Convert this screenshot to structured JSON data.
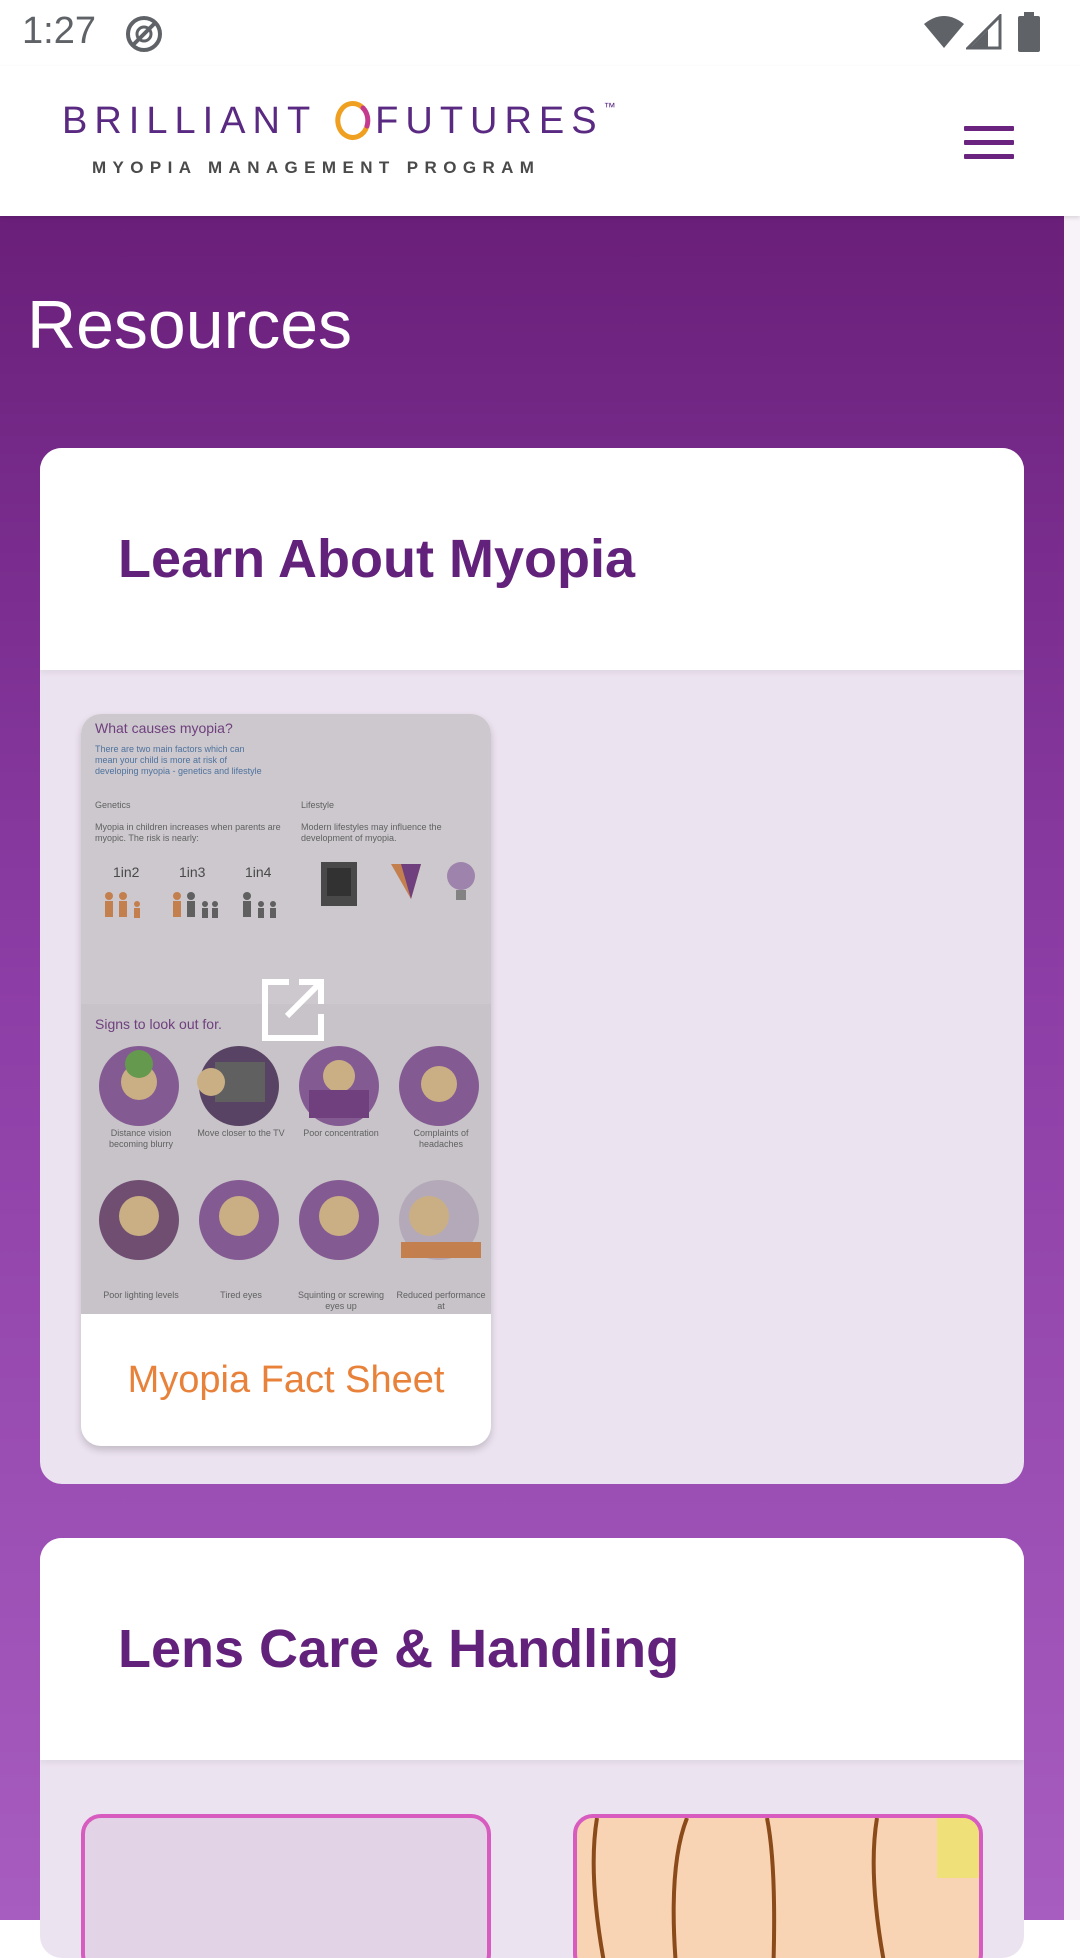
{
  "status_bar": {
    "time": "1:27",
    "icons": [
      "do-not-disturb-icon",
      "wifi-icon",
      "cell-signal-icon",
      "battery-icon"
    ]
  },
  "header": {
    "logo_word1": "BRILLIANT",
    "logo_word2": "FUTURES",
    "logo_trademark": "™",
    "logo_tagline": "MYOPIA MANAGEMENT PROGRAM",
    "menu_icon": "hamburger-menu-icon"
  },
  "page": {
    "title": "Resources"
  },
  "sections": [
    {
      "title": "Learn About Myopia",
      "items": [
        {
          "label": "Myopia Fact Sheet",
          "action_icon": "open-external-icon",
          "thumbnail": {
            "heading": "What causes myopia?",
            "intro": "There are two main factors which can mean your child is more at risk of developing myopia - genetics and lifestyle",
            "col1_title": "Genetics",
            "col2_title": "Lifestyle",
            "col1_text": "Myopia in children increases when parents are myopic. The risk is nearly:",
            "col2_text": "Modern lifestyles may influence the development of myopia.",
            "ratios": [
              "1in2",
              "1in3",
              "1in4"
            ],
            "signs_heading": "Signs to look out for.",
            "signs": [
              "Distance vision becoming blurry",
              "Move closer to the TV",
              "Poor concentration",
              "Complaints of headaches",
              "Poor lighting levels",
              "Tired eyes",
              "Squinting or screwing eyes up",
              "Reduced performance at"
            ]
          }
        }
      ]
    },
    {
      "title": "Lens Care & Handling",
      "items": []
    }
  ],
  "colors": {
    "brand_purple": "#62217a",
    "accent_orange": "#e8823a",
    "gradient_top": "#6a1f7a",
    "gradient_bottom": "#a75cbf"
  }
}
